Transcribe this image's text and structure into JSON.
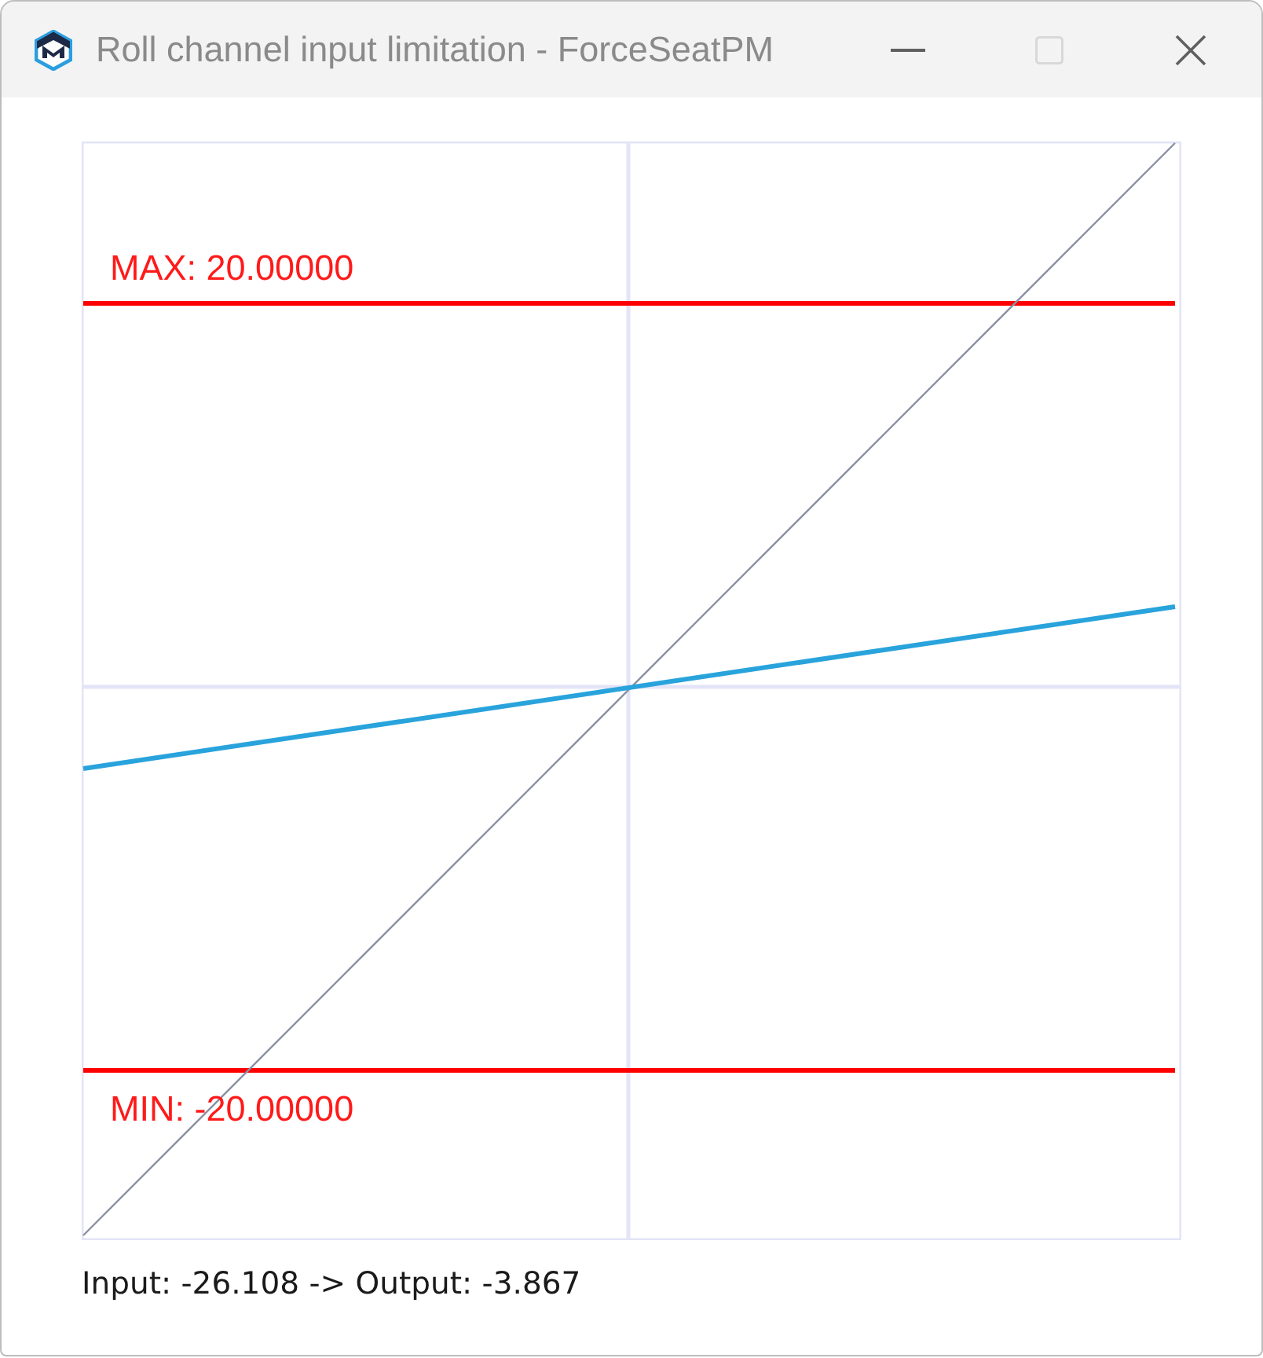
{
  "window": {
    "title": "Roll channel input limitation - ForceSeatPM",
    "controls": [
      {
        "kind": "minimize",
        "disabled": false
      },
      {
        "kind": "maximize",
        "disabled": true
      },
      {
        "kind": "close",
        "disabled": false
      }
    ]
  },
  "chart": {
    "max_label": "MAX: 20.00000",
    "min_label": "MIN: -20.00000"
  },
  "status": "Input: -26.108 -> Output: -3.867"
}
